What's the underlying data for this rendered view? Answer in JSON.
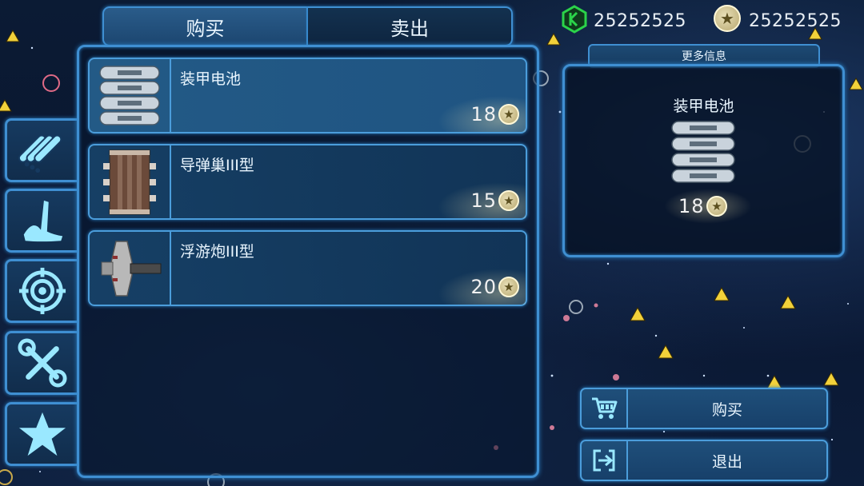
{
  "tabs": {
    "buy": "购买",
    "sell": "卖出"
  },
  "currency": {
    "crystal": "25252525",
    "stars": "25252525"
  },
  "items": [
    {
      "name": "装甲电池",
      "price": "18"
    },
    {
      "name": "导弹巢III型",
      "price": "15"
    },
    {
      "name": "浮游炮III型",
      "price": "20"
    }
  ],
  "sidebar": [
    "pipes-icon",
    "crane-arm-icon",
    "target-icon",
    "tools-icon",
    "star-icon"
  ],
  "detail": {
    "more_info": "更多信息",
    "name": "装甲电池",
    "price": "18"
  },
  "actions": {
    "buy": "购买",
    "exit": "退出"
  },
  "colors": {
    "frame": "#3f8fd2",
    "crystal": "#2bd34a",
    "coin": "#e8e0b8",
    "warning": "#f0d23a"
  }
}
